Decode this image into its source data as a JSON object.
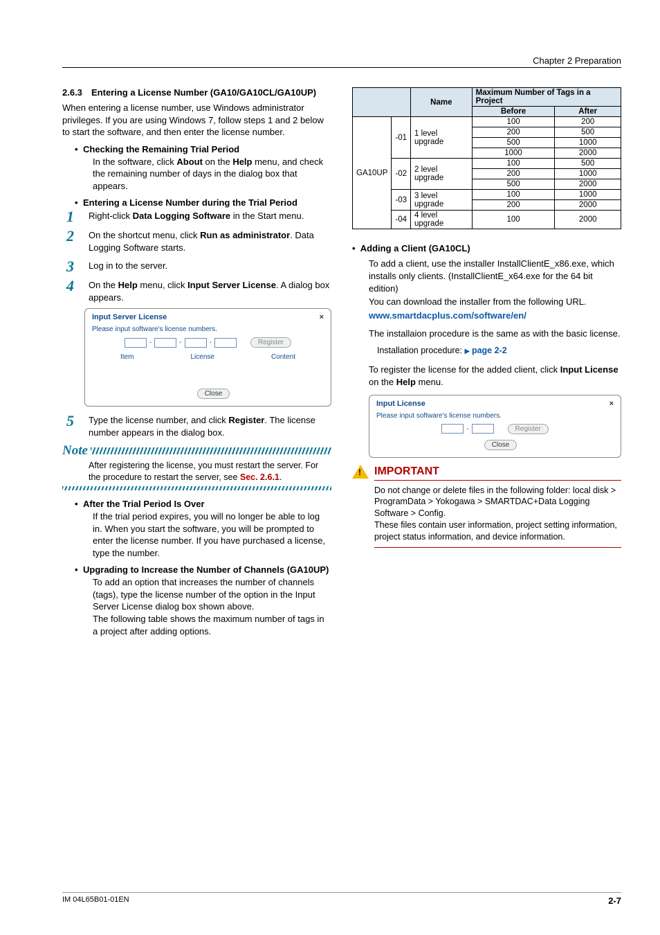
{
  "chapter_header": "Chapter 2  Preparation",
  "section": {
    "num": "2.6.3",
    "title": "Entering a License Number (GA10/GA10CL/GA10UP)"
  },
  "intro": "When entering a license number, use Windows administrator privileges. If you are using Windows 7, follow steps 1 and 2 below to start the software, and then enter the license number.",
  "sub1_title": "Checking the Remaining Trial Period",
  "sub1_body_a": "In the software, click ",
  "sub1_about": "About",
  "sub1_body_b": " on the ",
  "sub1_help": "Help",
  "sub1_body_c": " menu, and check the remaining number of days in the dialog box that appears.",
  "sub2_title": "Entering a License Number during the Trial Period",
  "step1_a": "Right-click ",
  "step1_b": "Data Logging Software",
  "step1_c": " in the Start menu.",
  "step2_a": "On the shortcut menu, click ",
  "step2_b": "Run as administrator",
  "step2_c": ". Data Logging Software starts.",
  "step3": "Log in to the server.",
  "step4_a": "On the ",
  "step4_b": "Help",
  "step4_c": " menu, click ",
  "step4_d": "Input Server License",
  "step4_e": ". A dialog box appears.",
  "dialog1": {
    "title": "Input Server License",
    "prompt": "Please input software's license numbers.",
    "register": "Register",
    "item": "Item",
    "license": "License",
    "content": "Content",
    "close": "Close"
  },
  "step5_a": "Type the license number, and click ",
  "step5_b": "Register",
  "step5_c": ". The license number appears in the dialog box.",
  "note_label": "Note",
  "note_body_a": "After registering the license, you must restart the server. For the procedure to restart the server, see ",
  "note_link": "Sec. 2.6.1",
  "note_body_b": ".",
  "sub3_title": "After the Trial Period Is Over",
  "sub3_body": "If the trial period expires, you will no longer be able to log in. When you start the software, you will be prompted to enter the license number. If you have purchased a license, type the number.",
  "sub4_title": "Upgrading to Increase the Number of Channels (GA10UP)",
  "sub4_body": "To add an option that increases the number of channels (tags), type the license number of the option in the Input Server License dialog box shown above.\nThe following table shows the maximum number of tags in a project after adding options.",
  "table": {
    "h_name": "Name",
    "h_max": "Maximum Number of Tags in a Project",
    "h_before": "Before",
    "h_after": "After",
    "product": "GA10UP",
    "rows": [
      {
        "suffix": "-01",
        "name": "1 level upgrade",
        "pairs": [
          [
            "100",
            "200"
          ],
          [
            "200",
            "500"
          ],
          [
            "500",
            "1000"
          ],
          [
            "1000",
            "2000"
          ]
        ]
      },
      {
        "suffix": "-02",
        "name": "2 level upgrade",
        "pairs": [
          [
            "100",
            "500"
          ],
          [
            "200",
            "1000"
          ],
          [
            "500",
            "2000"
          ]
        ]
      },
      {
        "suffix": "-03",
        "name": "3 level upgrade",
        "pairs": [
          [
            "100",
            "1000"
          ],
          [
            "200",
            "2000"
          ]
        ]
      },
      {
        "suffix": "-04",
        "name": "4 level upgrade",
        "pairs": [
          [
            "100",
            "2000"
          ]
        ]
      }
    ]
  },
  "client_title": "Adding a Client (GA10CL)",
  "client_body1": "To add a client, use the installer InstallClientE_x86.exe, which installs only clients. (InstallClientE_x64.exe for the 64 bit edition)\nYou can download the installer from the following URL.",
  "client_url": "www.smartdacplus.com/software/en/",
  "client_body2": "The installaion procedure is the same as with the basic license.",
  "install_label": "Installation procedure: ",
  "install_link": "page 2-2",
  "client_body3_a": "To register the license for the added client, click ",
  "client_body3_b": "Input License",
  "client_body3_c": " on the ",
  "client_body3_d": "Help",
  "client_body3_e": " menu.",
  "dialog2": {
    "title": "Input License",
    "prompt": "Please input software's license numbers.",
    "register": "Register",
    "close": "Close"
  },
  "important": {
    "title": "IMPORTANT",
    "body1": "Do not change or delete files in the following folder: local disk > ProgramData > Yokogawa > SMARTDAC+Data Logging Software > Config.",
    "body2": "These files contain user information, project setting information, project status information, and device information."
  },
  "footer_left": "IM 04L65B01-01EN",
  "footer_right": "2-7"
}
